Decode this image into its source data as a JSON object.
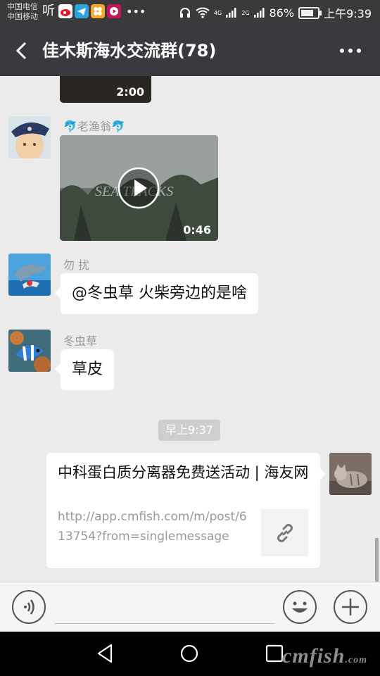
{
  "status_bar": {
    "carrier_1": "中国电信",
    "carrier_2": "中国移动",
    "ting_icon": "听",
    "network_tag_1": "4G",
    "network_tag_2": "2G",
    "battery_text": "86%",
    "battery_level": 0.86,
    "time": "上午9:39"
  },
  "header": {
    "title": "佳木斯海水交流群(78)"
  },
  "messages": {
    "video_1": {
      "duration": "2:00"
    },
    "msg_2": {
      "sender": "老渔翁",
      "sender_emoji": "🐬",
      "duration": "0:46"
    },
    "msg_3": {
      "sender": "勿 扰",
      "text": "@冬虫草  火柴旁边的是啥"
    },
    "msg_4": {
      "sender": "冬虫草",
      "text": "草皮"
    },
    "timestamp": "早上9:37",
    "msg_5": {
      "title": "中科蛋白质分离器免费送活动 | 海友网",
      "url": "http://app.cmfish.com/m/post/613754?from=singlemessage"
    }
  },
  "watermark": {
    "main": "cmfish",
    "suffix": ".com"
  },
  "colors": {
    "header_bg": "#393a3f",
    "chat_bg": "#ebebeb",
    "bubble": "#ffffff"
  }
}
